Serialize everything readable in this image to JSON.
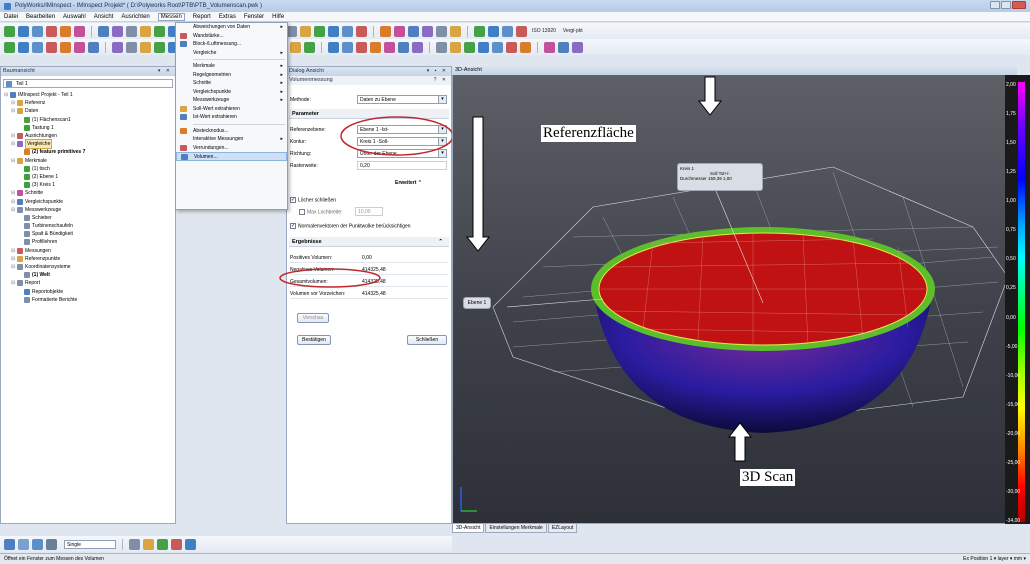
{
  "window": {
    "title": "PolyWorks/IMInspect - IMInspect Projekt* ( D:\\Polyworks Root\\PTB\\PTB_Volumenscan.pwk )"
  },
  "menubar": [
    "Datei",
    "Bearbeiten",
    "Auswahl",
    "Ansicht",
    "Ausrichten",
    "Messen",
    "Report",
    "Extras",
    "Fenster",
    "Hilfe"
  ],
  "toolbar": {
    "iso_text": "ISO 13920",
    "vergl_text": "Vergl-pkt"
  },
  "tree": {
    "title": "Baumansicht",
    "combo": "Teil 1",
    "items": [
      {
        "label": "IMInspect Projekt - Teil 1",
        "indent": 0,
        "icon": "#4f7fbf",
        "bold": false,
        "sel": false
      },
      {
        "label": "Referenz",
        "indent": 1,
        "icon": "#d9a441",
        "bold": false,
        "sel": false
      },
      {
        "label": "Daten",
        "indent": 1,
        "icon": "#d9a441",
        "bold": false,
        "sel": false
      },
      {
        "label": "(1) Flächenscan1",
        "indent": 2,
        "icon": "#46a046",
        "bold": false,
        "sel": false
      },
      {
        "label": "Tastung 1",
        "indent": 2,
        "icon": "#3aa23a",
        "bold": false,
        "sel": false
      },
      {
        "label": "Ausrichtungen",
        "indent": 1,
        "icon": "#c85a5a",
        "bold": false,
        "sel": false
      },
      {
        "label": "Vergleiche",
        "indent": 1,
        "icon": "#8a6bc2",
        "bold": false,
        "sel": true
      },
      {
        "label": "(2) feature primitives 7",
        "indent": 2,
        "icon": "#d97d2b",
        "bold": true,
        "sel": false
      },
      {
        "label": "Merkmale",
        "indent": 1,
        "icon": "#d9a441",
        "bold": false,
        "sel": false
      },
      {
        "label": "(1) tisch",
        "indent": 2,
        "icon": "#3aa23a",
        "bold": false,
        "sel": false
      },
      {
        "label": "(2) Ebene 1",
        "indent": 2,
        "icon": "#3aa23a",
        "bold": false,
        "sel": false
      },
      {
        "label": "(3) Kreis 1",
        "indent": 2,
        "icon": "#3aa23a",
        "bold": false,
        "sel": false
      },
      {
        "label": "Schnitte",
        "indent": 1,
        "icon": "#c44f9a",
        "bold": false,
        "sel": false
      },
      {
        "label": "Vergleichspunkte",
        "indent": 1,
        "icon": "#4f7fbf",
        "bold": false,
        "sel": false
      },
      {
        "label": "Messwerkzeuge",
        "indent": 1,
        "icon": "#7f8fa6",
        "bold": false,
        "sel": false
      },
      {
        "label": "Schieber",
        "indent": 2,
        "icon": "#7f8fa6",
        "bold": false,
        "sel": false
      },
      {
        "label": "Turbinenschaufeln",
        "indent": 2,
        "icon": "#7f8fa6",
        "bold": false,
        "sel": false
      },
      {
        "label": "Spalt & Bündigkeit",
        "indent": 2,
        "icon": "#7f8fa6",
        "bold": false,
        "sel": false
      },
      {
        "label": "Profillehren",
        "indent": 2,
        "icon": "#7f8fa6",
        "bold": false,
        "sel": false
      },
      {
        "label": "Messungen",
        "indent": 1,
        "icon": "#c85a5a",
        "bold": false,
        "sel": false
      },
      {
        "label": "Referenzpunkte",
        "indent": 1,
        "icon": "#d9a441",
        "bold": false,
        "sel": false
      },
      {
        "label": "Koordinatensysteme",
        "indent": 1,
        "icon": "#7f8fa6",
        "bold": false,
        "sel": false
      },
      {
        "label": "(1) Welt",
        "indent": 2,
        "icon": "#7f8fa6",
        "bold": true,
        "sel": false
      },
      {
        "label": "Report",
        "indent": 1,
        "icon": "#7f8fa6",
        "bold": false,
        "sel": false
      },
      {
        "label": "Reportobjekte",
        "indent": 2,
        "icon": "#4f7fbf",
        "bold": false,
        "sel": false
      },
      {
        "label": "Formatierte Berichte",
        "indent": 2,
        "icon": "#7f8fa6",
        "bold": false,
        "sel": false
      }
    ]
  },
  "menu": {
    "items": [
      {
        "label": "Abweichungen von Daten",
        "arrow": true,
        "icon": "",
        "hl": false,
        "sep_after": false
      },
      {
        "label": "Wandstärke...",
        "arrow": false,
        "icon": "#c85a5a",
        "hl": false,
        "sep_after": false
      },
      {
        "label": "Block-/Luftmessung...",
        "arrow": false,
        "icon": "#4f7fbf",
        "hl": false,
        "sep_after": false
      },
      {
        "label": "Vergleiche",
        "arrow": true,
        "icon": "",
        "hl": false,
        "sep_after": true
      },
      {
        "label": "Merkmale",
        "arrow": true,
        "icon": "",
        "hl": false,
        "sep_after": false
      },
      {
        "label": "Regelgeometrien",
        "arrow": true,
        "icon": "",
        "hl": false,
        "sep_after": false
      },
      {
        "label": "Schnitte",
        "arrow": true,
        "icon": "",
        "hl": false,
        "sep_after": false
      },
      {
        "label": "Vergleichspunkte",
        "arrow": true,
        "icon": "",
        "hl": false,
        "sep_after": false
      },
      {
        "label": "Messwerkzeuge",
        "arrow": true,
        "icon": "",
        "hl": false,
        "sep_after": false
      },
      {
        "label": "Soll-Wert extrahieren",
        "arrow": false,
        "icon": "#d9a441",
        "hl": false,
        "sep_after": false
      },
      {
        "label": "Ist-Wert extrahieren",
        "arrow": false,
        "icon": "#4f7fbf",
        "hl": false,
        "sep_after": true
      },
      {
        "label": "Abstecknodus...",
        "arrow": false,
        "icon": "#d97d2b",
        "hl": false,
        "sep_after": false
      },
      {
        "label": "Interaktive Messungen",
        "arrow": true,
        "icon": "",
        "hl": false,
        "sep_after": false
      },
      {
        "label": "Verrundungen...",
        "arrow": false,
        "icon": "#c85a5a",
        "hl": false,
        "sep_after": false
      },
      {
        "label": "Volumen...",
        "arrow": false,
        "icon": "#4f7fbf",
        "hl": true,
        "sep_after": false
      }
    ]
  },
  "dialog": {
    "title": "Dialog Ansicht",
    "subtitle": "Volumenmessung",
    "methode_label": "Methode:",
    "methode_value": "Daten zu Ebene",
    "parameter_title": "Parameter",
    "referenzebene_label": "Referenzebene:",
    "referenzebene_value": "Ebene 1 -Ist-",
    "kontur_label": "Kontur:",
    "kontur_value": "Kreis 1 -Soll-",
    "richtung_label": "Richtung:",
    "richtung_value": "Unter der Ebene",
    "rasterweite_label": "Rasterweite:",
    "rasterweite_value": "0,20",
    "erweitert_label": "Erweitert",
    "loecher_label": "Löcher schließen",
    "max_lochbreite_label": "Max Lochbreite:",
    "max_lochbreite_value": "10,00",
    "normalen_label": "Normalenvektoren der Punktwolke berücksichtigen",
    "ergebnisse_title": "Ergebnisse",
    "positives_label": "Positives Volumen:",
    "positives_value": "0,00",
    "negatives_label": "Negatives Volumen:",
    "negatives_value": "414325,48",
    "gesamt_label": "Gesamtvolumen:",
    "gesamt_value": "414325,48",
    "vor_label": "Volumen vor Vorzeichen:",
    "vor_value": "414325,48",
    "vorschau_btn": "Vorschau",
    "bestaetigen_btn": "Bestätigen",
    "schliessen_btn": "Schließen"
  },
  "view": {
    "title": "3D-Ansicht",
    "kreis_tip": {
      "name": "Kreis 1",
      "head": "Soll   Tol+/-",
      "row": "Durchmesser  159,39  1,00"
    },
    "ebene_tip": "Ebene 1",
    "annot_ref": "Referenzfläche",
    "annot_scan": "3D Scan",
    "scale": [
      "2,00",
      "1,75",
      "1,50",
      "1,25",
      "1,00",
      "0,75",
      "0,50",
      "0,25",
      "0,00",
      "-5,00",
      "-10,00",
      "-15,00",
      "-20,00",
      "-25,00",
      "-30,00",
      "-34,00"
    ],
    "tabs": [
      "3D-Ansicht",
      "Einstellungen Merkmale",
      "EZLayout"
    ]
  },
  "bottom": {
    "single_label": "Single"
  },
  "status": {
    "left": "Öffnet ein Fenster zum Messen des Volumen",
    "right": "Ex Position 1  ▾  layer  ▾  mm  ▾"
  },
  "colors": {
    "red_surface": "#c01212",
    "green_rim": "#5cbf2a",
    "highlight_oval": "#c0282d"
  }
}
